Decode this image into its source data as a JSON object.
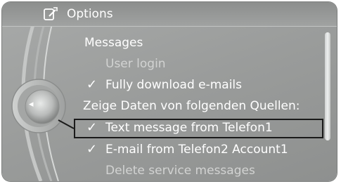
{
  "header": {
    "title": "Options",
    "icon": "options-edit-icon"
  },
  "menu": {
    "items": [
      {
        "label": "Messages",
        "checked": false,
        "enabled": true
      },
      {
        "label": "User login",
        "checked": false,
        "enabled": false
      },
      {
        "label": "Fully download e-mails",
        "checked": true,
        "enabled": true
      },
      {
        "label": "Zeige Daten von folgenden Quellen:",
        "checked": false,
        "enabled": true
      },
      {
        "label": "Text message from Telefon1",
        "checked": true,
        "enabled": true,
        "selected": true
      },
      {
        "label": "E-mail from Telefon2 Account1",
        "checked": true,
        "enabled": true
      },
      {
        "label": "Delete service messages",
        "checked": false,
        "enabled": false
      }
    ],
    "check_glyph": "✓"
  },
  "controller": {
    "arrow_glyph": "◂",
    "icon": "controller-knob-icon"
  },
  "colors": {
    "background": "#9a9c9b",
    "text": "#ffffff",
    "disabled_text": "#d2d3d2",
    "highlight": "#1a1a1a"
  }
}
